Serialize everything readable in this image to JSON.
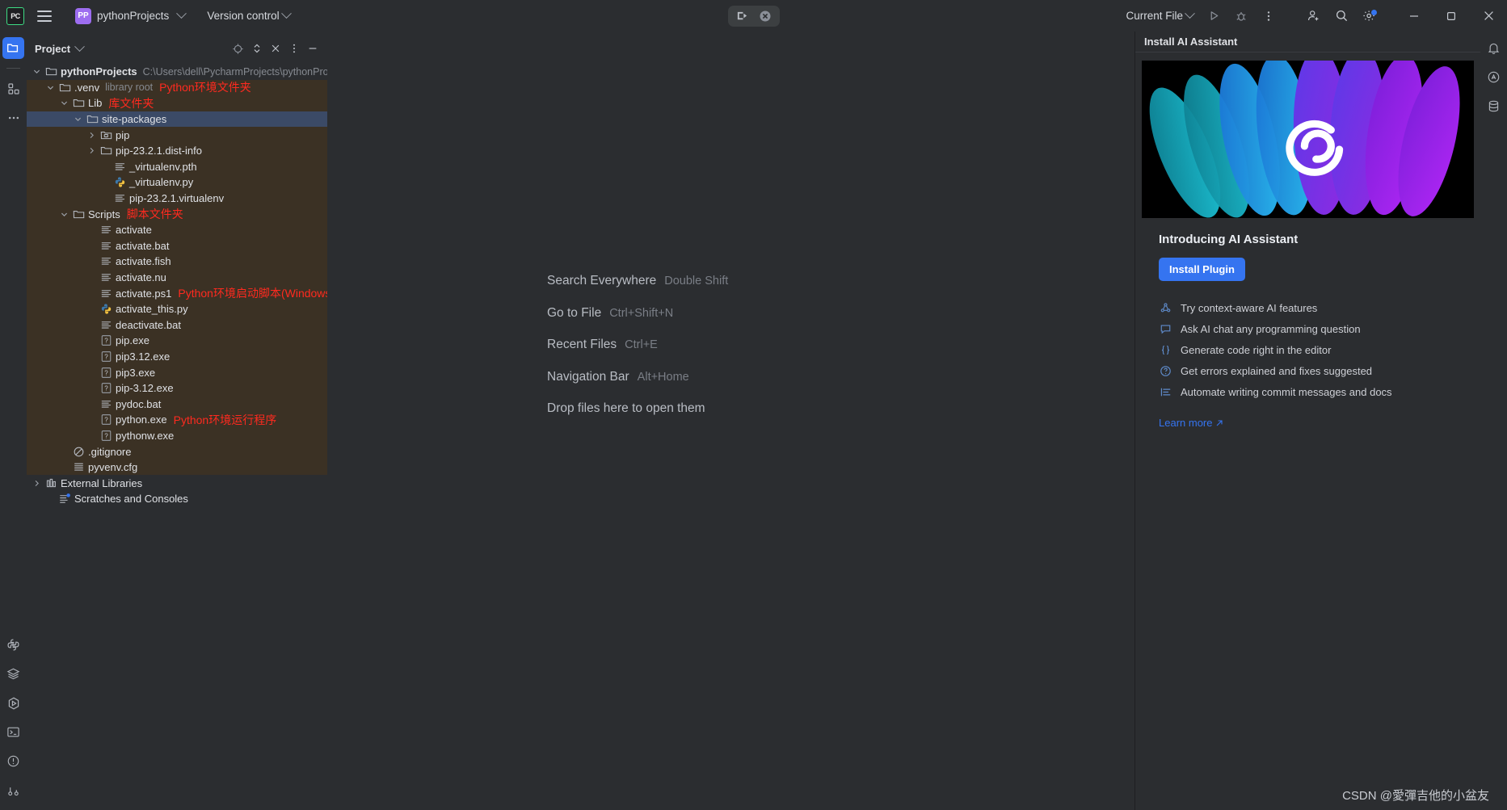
{
  "titlebar": {
    "app_badge": "PC",
    "menu_icon": "hamburger-icon",
    "project_initials": "PP",
    "project_name": "pythonProjects",
    "version_control": "Version control",
    "run_config": "Current File",
    "run_icon": "run-icon",
    "debug_icon": "debug-icon",
    "more_icon": "more-vertical-icon",
    "account_icon": "account-add-icon",
    "search_icon": "search-icon",
    "settings_icon": "gear-icon",
    "minimize": "minimize-icon",
    "maximize": "maximize-icon",
    "close": "close-icon"
  },
  "left_rail": {
    "items": [
      {
        "name": "project-tool-window",
        "icon": "folder-icon",
        "active": true
      },
      {
        "name": "commit-tool-window",
        "icon": "structure-icon",
        "active": false
      },
      {
        "name": "more-tool-windows",
        "icon": "ellipsis-icon",
        "active": false
      }
    ],
    "bottom_items": [
      {
        "name": "python-packages",
        "icon": "python-icon"
      },
      {
        "name": "database-stack",
        "icon": "layers-icon"
      },
      {
        "name": "run-tool-window",
        "icon": "run-hex-icon"
      },
      {
        "name": "terminal-tool-window",
        "icon": "terminal-icon"
      },
      {
        "name": "problems-tool-window",
        "icon": "warning-circle-icon"
      },
      {
        "name": "version-control-tool-window",
        "icon": "branch-icon"
      }
    ]
  },
  "project_panel": {
    "title": "Project",
    "actions": [
      "target-icon",
      "expand-collapse-icon",
      "collapse-all-icon",
      "options-icon",
      "hide-icon"
    ],
    "tree": [
      {
        "depth": 0,
        "label": "pythonProjects",
        "bold": true,
        "icon": "folder-icon",
        "twist": "down",
        "note": "C:\\Users\\dell\\PycharmProjects\\pythonProjects",
        "anno": "",
        "bg": "normal"
      },
      {
        "depth": 1,
        "label": ".venv",
        "bold": false,
        "icon": "folder-icon",
        "twist": "down",
        "note": "library root",
        "anno": "Python环境文件夹",
        "bg": "venv"
      },
      {
        "depth": 2,
        "label": "Lib",
        "bold": false,
        "icon": "folder-icon",
        "twist": "down",
        "note": "",
        "anno": "库文件夹",
        "bg": "venv"
      },
      {
        "depth": 3,
        "label": "site-packages",
        "bold": false,
        "icon": "folder-icon",
        "twist": "down",
        "note": "",
        "anno": "",
        "bg": "selected"
      },
      {
        "depth": 4,
        "label": "pip",
        "bold": false,
        "icon": "package-folder-icon",
        "twist": "right",
        "note": "",
        "anno": "",
        "bg": "venv"
      },
      {
        "depth": 4,
        "label": "pip-23.2.1.dist-info",
        "bold": false,
        "icon": "folder-icon",
        "twist": "right",
        "note": "",
        "anno": "",
        "bg": "venv"
      },
      {
        "depth": 5,
        "label": "_virtualenv.pth",
        "bold": false,
        "icon": "text-file-icon",
        "twist": "none",
        "note": "",
        "anno": "",
        "bg": "venv"
      },
      {
        "depth": 5,
        "label": "_virtualenv.py",
        "bold": false,
        "icon": "python-file-icon",
        "twist": "none",
        "note": "",
        "anno": "",
        "bg": "venv"
      },
      {
        "depth": 5,
        "label": "pip-23.2.1.virtualenv",
        "bold": false,
        "icon": "text-file-icon",
        "twist": "none",
        "note": "",
        "anno": "",
        "bg": "venv"
      },
      {
        "depth": 2,
        "label": "Scripts",
        "bold": false,
        "icon": "folder-icon",
        "twist": "down",
        "note": "",
        "anno": "脚本文件夹",
        "bg": "venv"
      },
      {
        "depth": 4,
        "label": "activate",
        "bold": false,
        "icon": "text-file-icon",
        "twist": "none",
        "note": "",
        "anno": "",
        "bg": "venv"
      },
      {
        "depth": 4,
        "label": "activate.bat",
        "bold": false,
        "icon": "text-file-icon",
        "twist": "none",
        "note": "",
        "anno": "",
        "bg": "venv"
      },
      {
        "depth": 4,
        "label": "activate.fish",
        "bold": false,
        "icon": "text-file-icon",
        "twist": "none",
        "note": "",
        "anno": "",
        "bg": "venv"
      },
      {
        "depth": 4,
        "label": "activate.nu",
        "bold": false,
        "icon": "text-file-icon",
        "twist": "none",
        "note": "",
        "anno": "",
        "bg": "venv"
      },
      {
        "depth": 4,
        "label": "activate.ps1",
        "bold": false,
        "icon": "text-file-icon",
        "twist": "none",
        "note": "",
        "anno": "Python环境启动脚本(Windows)",
        "bg": "venv"
      },
      {
        "depth": 4,
        "label": "activate_this.py",
        "bold": false,
        "icon": "python-file-icon",
        "twist": "none",
        "note": "",
        "anno": "",
        "bg": "venv"
      },
      {
        "depth": 4,
        "label": "deactivate.bat",
        "bold": false,
        "icon": "text-file-icon",
        "twist": "none",
        "note": "",
        "anno": "",
        "bg": "venv"
      },
      {
        "depth": 4,
        "label": "pip.exe",
        "bold": false,
        "icon": "unknown-file-icon",
        "twist": "none",
        "note": "",
        "anno": "",
        "bg": "venv"
      },
      {
        "depth": 4,
        "label": "pip3.12.exe",
        "bold": false,
        "icon": "unknown-file-icon",
        "twist": "none",
        "note": "",
        "anno": "",
        "bg": "venv"
      },
      {
        "depth": 4,
        "label": "pip3.exe",
        "bold": false,
        "icon": "unknown-file-icon",
        "twist": "none",
        "note": "",
        "anno": "",
        "bg": "venv"
      },
      {
        "depth": 4,
        "label": "pip-3.12.exe",
        "bold": false,
        "icon": "unknown-file-icon",
        "twist": "none",
        "note": "",
        "anno": "",
        "bg": "venv"
      },
      {
        "depth": 4,
        "label": "pydoc.bat",
        "bold": false,
        "icon": "text-file-icon",
        "twist": "none",
        "note": "",
        "anno": "",
        "bg": "venv"
      },
      {
        "depth": 4,
        "label": "python.exe",
        "bold": false,
        "icon": "unknown-file-icon",
        "twist": "none",
        "note": "",
        "anno": "Python环境运行程序",
        "bg": "venv"
      },
      {
        "depth": 4,
        "label": "pythonw.exe",
        "bold": false,
        "icon": "unknown-file-icon",
        "twist": "none",
        "note": "",
        "anno": "",
        "bg": "venv"
      },
      {
        "depth": 2,
        "label": ".gitignore",
        "bold": false,
        "icon": "gitignore-icon",
        "twist": "none",
        "note": "",
        "anno": "",
        "bg": "venv"
      },
      {
        "depth": 2,
        "label": "pyvenv.cfg",
        "bold": false,
        "icon": "config-file-icon",
        "twist": "none",
        "note": "",
        "anno": "",
        "bg": "venv"
      },
      {
        "depth": 0,
        "label": "External Libraries",
        "bold": false,
        "icon": "library-icon",
        "twist": "right",
        "note": "",
        "anno": "",
        "bg": "normal"
      },
      {
        "depth": 1,
        "label": "Scratches and Consoles",
        "bold": false,
        "icon": "scratches-icon",
        "twist": "none",
        "note": "",
        "anno": "",
        "bg": "normal"
      }
    ]
  },
  "editor": {
    "hints": [
      {
        "label": "Search Everywhere",
        "key": "Double Shift"
      },
      {
        "label": "Go to File",
        "key": "Ctrl+Shift+N"
      },
      {
        "label": "Recent Files",
        "key": "Ctrl+E"
      },
      {
        "label": "Navigation Bar",
        "key": "Alt+Home"
      }
    ],
    "drop_text": "Drop files here to open them"
  },
  "ai_panel": {
    "header_title": "Install AI Assistant",
    "heading": "Introducing AI Assistant",
    "install_button": "Install Plugin",
    "features": [
      {
        "icon": "context-aware-icon",
        "text": "Try context-aware AI features"
      },
      {
        "icon": "chat-bubble-icon",
        "text": "Ask AI chat any programming question"
      },
      {
        "icon": "braces-icon",
        "text": "Generate code right in the editor"
      },
      {
        "icon": "question-circle-icon",
        "text": "Get errors explained and fixes suggested"
      },
      {
        "icon": "commit-lines-icon",
        "text": "Automate writing commit messages and docs"
      }
    ],
    "learn_more": "Learn more"
  },
  "right_rail": {
    "items": [
      {
        "name": "notifications-tool-window",
        "icon": "bell-icon"
      },
      {
        "name": "ai-assistant-tool-window",
        "icon": "ai-icon"
      },
      {
        "name": "database-tool-window",
        "icon": "database-icon"
      }
    ]
  },
  "watermark": "CSDN @愛彈吉他的小盆友",
  "colors": {
    "accent": "#3574f0",
    "annotation_red": "#ff2a1f",
    "venv_bg": "#3b3124",
    "selection": "#3b4a66",
    "background": "#2b2d30"
  }
}
